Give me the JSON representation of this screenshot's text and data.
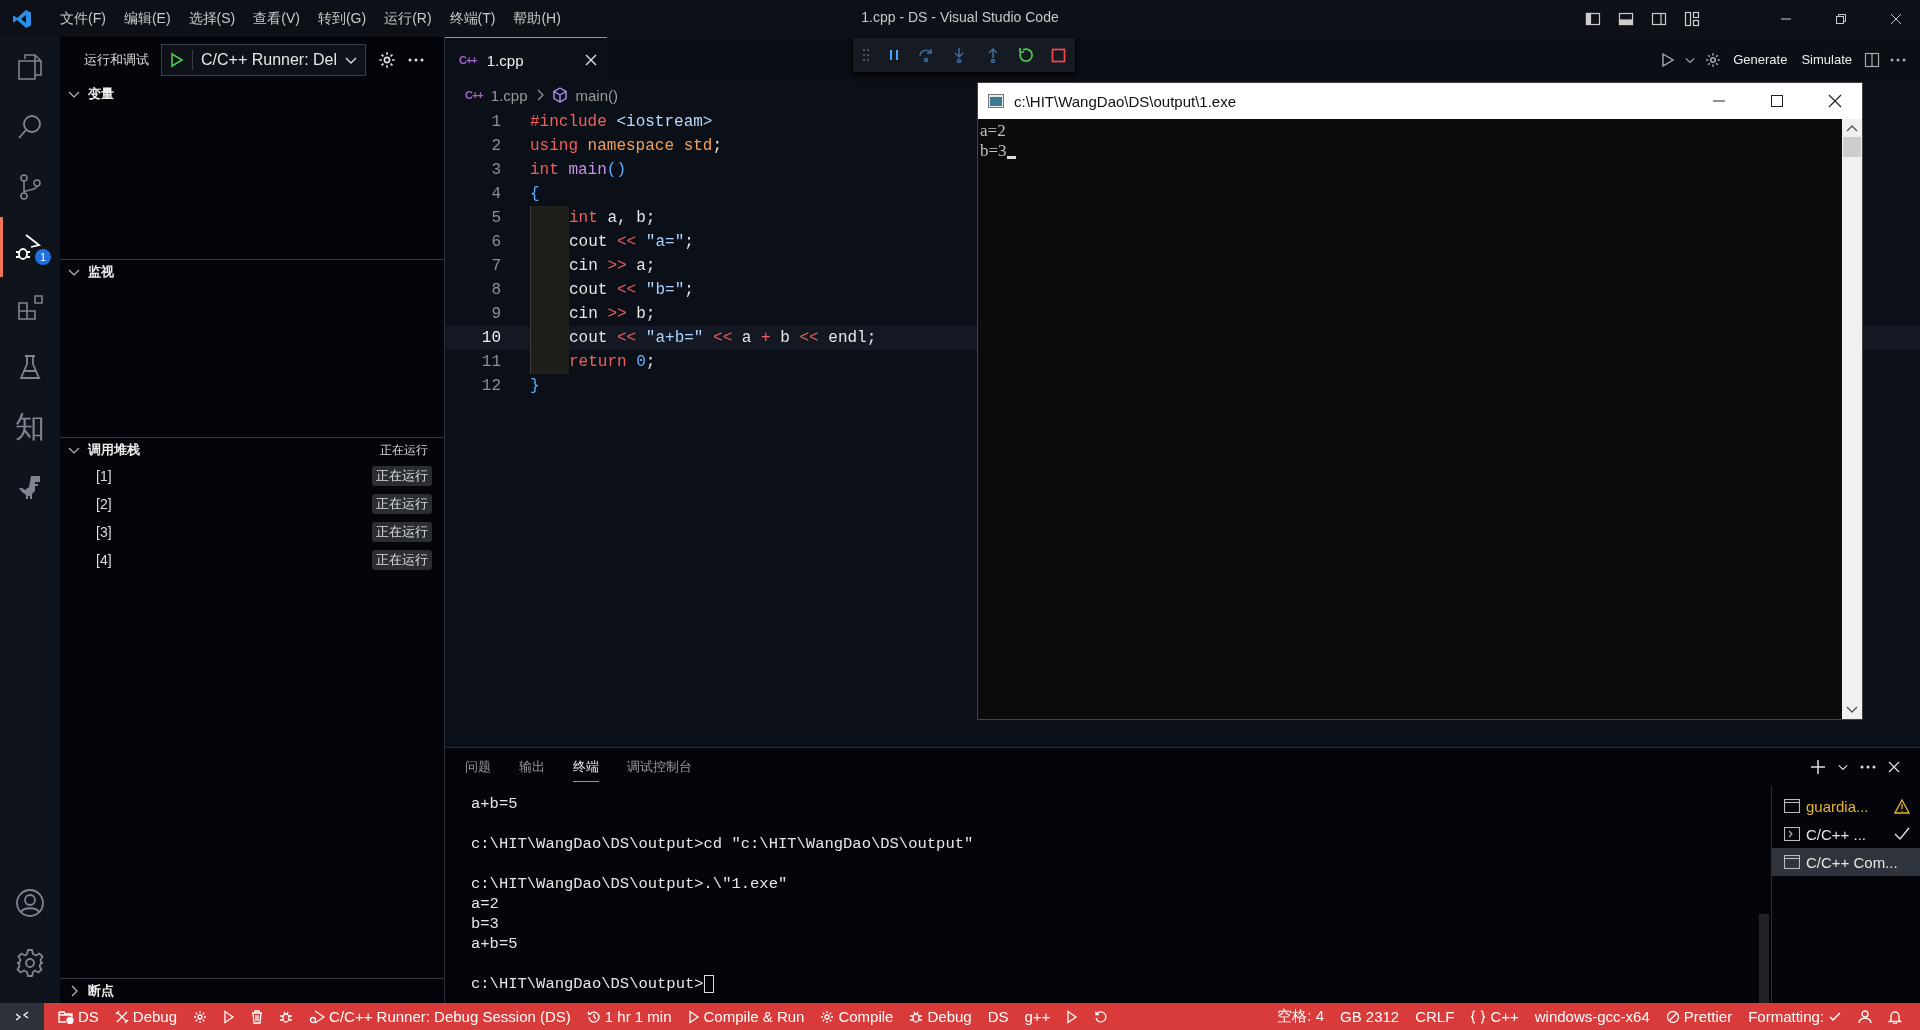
{
  "window": {
    "title": "1.cpp - DS - Visual Studio Code"
  },
  "menu": [
    "文件(F)",
    "编辑(E)",
    "选择(S)",
    "查看(V)",
    "转到(G)",
    "运行(R)",
    "终端(T)",
    "帮助(H)"
  ],
  "activity_bar": {
    "items": [
      {
        "selected": false
      },
      {
        "selected": false
      },
      {
        "selected": false
      },
      {
        "selected": true,
        "badge": "1"
      },
      {
        "selected": false
      },
      {
        "selected": false
      },
      {
        "text": "知",
        "selected": false
      },
      {
        "selected": false
      }
    ]
  },
  "sidebar": {
    "title": "运行和调试",
    "config": "C/C++ Runner: Del",
    "sections": [
      {
        "kind": "empty",
        "title": "变量",
        "expanded": true
      },
      {
        "kind": "empty",
        "title": "监视",
        "expanded": true
      },
      {
        "kind": "stack",
        "title": "调用堆栈",
        "expanded": true,
        "status": "正在运行",
        "rows": [
          {
            "label": "[1]",
            "status": "正在运行"
          },
          {
            "label": "[2]",
            "status": "正在运行"
          },
          {
            "label": "[3]",
            "status": "正在运行"
          },
          {
            "label": "[4]",
            "status": "正在运行"
          }
        ]
      },
      {
        "kind": "empty",
        "title": "断点",
        "expanded": false
      }
    ]
  },
  "editor": {
    "tabs": [
      {
        "badge": "C++",
        "label": "1.cpp",
        "selected": true
      }
    ],
    "breadcrumb_badge": "C++",
    "breadcrumb": [
      "1.cpp",
      "main()"
    ],
    "toolbar_buttons": [
      "Generate",
      "Simulate"
    ],
    "lines": [
      {
        "number": "1",
        "current": false,
        "indented": false,
        "tokens": [
          {
            "text": "#include ",
            "kind": "keyword"
          },
          {
            "text": "<iostream>",
            "kind": "header"
          }
        ]
      },
      {
        "number": "2",
        "current": false,
        "indented": false,
        "tokens": [
          {
            "text": "using ",
            "kind": "keyword"
          },
          {
            "text": "namespace std",
            "kind": "namespace"
          },
          {
            "text": ";",
            "kind": "plain"
          }
        ]
      },
      {
        "number": "3",
        "current": false,
        "indented": false,
        "tokens": [
          {
            "text": "int ",
            "kind": "keyword"
          },
          {
            "text": "main",
            "kind": "function"
          },
          {
            "text": "()",
            "kind": "bracket"
          }
        ]
      },
      {
        "number": "4",
        "current": false,
        "indented": false,
        "tokens": [
          {
            "text": "{",
            "kind": "bracket"
          }
        ]
      },
      {
        "number": "5",
        "current": false,
        "indented": true,
        "tokens": [
          {
            "text": "int",
            "kind": "keyword"
          },
          {
            "text": " a, b;",
            "kind": "plain"
          }
        ]
      },
      {
        "number": "6",
        "current": false,
        "indented": true,
        "tokens": [
          {
            "text": "cout ",
            "kind": "plain"
          },
          {
            "text": "<< ",
            "kind": "operator"
          },
          {
            "text": "\"a=\"",
            "kind": "string"
          },
          {
            "text": ";",
            "kind": "plain"
          }
        ]
      },
      {
        "number": "7",
        "current": false,
        "indented": true,
        "tokens": [
          {
            "text": "cin ",
            "kind": "plain"
          },
          {
            "text": ">>",
            "kind": "operator"
          },
          {
            "text": " a;",
            "kind": "plain"
          }
        ]
      },
      {
        "number": "8",
        "current": false,
        "indented": true,
        "tokens": [
          {
            "text": "cout ",
            "kind": "plain"
          },
          {
            "text": "<< ",
            "kind": "operator"
          },
          {
            "text": "\"b=\"",
            "kind": "string"
          },
          {
            "text": ";",
            "kind": "plain"
          }
        ]
      },
      {
        "number": "9",
        "current": false,
        "indented": true,
        "tokens": [
          {
            "text": "cin ",
            "kind": "plain"
          },
          {
            "text": ">>",
            "kind": "operator"
          },
          {
            "text": " b;",
            "kind": "plain"
          }
        ]
      },
      {
        "number": "10",
        "current": true,
        "indented": true,
        "tokens": [
          {
            "text": "cout ",
            "kind": "plain"
          },
          {
            "text": "<< ",
            "kind": "operator"
          },
          {
            "text": "\"a+b=\" ",
            "kind": "string"
          },
          {
            "text": "<< ",
            "kind": "operator"
          },
          {
            "text": "a ",
            "kind": "plain"
          },
          {
            "text": "+ ",
            "kind": "operator"
          },
          {
            "text": "b ",
            "kind": "plain"
          },
          {
            "text": "<< ",
            "kind": "operator"
          },
          {
            "text": "endl;",
            "kind": "plain"
          }
        ]
      },
      {
        "number": "11",
        "current": false,
        "indented": true,
        "tokens": [
          {
            "text": "return ",
            "kind": "keyword"
          },
          {
            "text": "0",
            "kind": "number"
          },
          {
            "text": ";",
            "kind": "plain"
          }
        ]
      },
      {
        "number": "12",
        "current": false,
        "indented": false,
        "tokens": [
          {
            "text": "}",
            "kind": "bracket"
          }
        ]
      }
    ]
  },
  "console_window": {
    "title": "c:\\HIT\\WangDao\\DS\\output\\1.exe",
    "lines": [
      "a=2",
      "b=3"
    ]
  },
  "panel": {
    "tabs": [
      {
        "label": "问题",
        "selected": false
      },
      {
        "label": "输出",
        "selected": false
      },
      {
        "label": "终端",
        "selected": true
      },
      {
        "label": "调试控制台",
        "selected": false
      }
    ],
    "terminal_blocks": [
      [
        "a+b=5"
      ],
      [
        "c:\\HIT\\WangDao\\DS\\output>cd \"c:\\HIT\\WangDao\\DS\\output\""
      ],
      [
        "c:\\HIT\\WangDao\\DS\\output>.\\\"1.exe\"",
        "a=2",
        "b=3",
        "a+b=5"
      ],
      [
        "c:\\HIT\\WangDao\\DS\\output>"
      ]
    ],
    "terminals": [
      {
        "label": "guardia...",
        "kind": "warning",
        "selected": false
      },
      {
        "label": "C/C++ ...",
        "kind": "done",
        "selected": false
      },
      {
        "label": "C/C++ Com...",
        "kind": "plain",
        "selected": true
      }
    ]
  },
  "status_bar": {
    "left": [
      {
        "kind": "remote"
      },
      {
        "kind": "folder",
        "text": "DS"
      },
      {
        "kind": "tools",
        "text": "Debug"
      },
      {
        "kind": "gear"
      },
      {
        "kind": "play"
      },
      {
        "kind": "trash"
      },
      {
        "kind": "bug"
      },
      {
        "kind": "debug-run",
        "text": "C/C++ Runner: Debug Session (DS)"
      },
      {
        "kind": "history",
        "text": "1 hr 1 min"
      },
      {
        "kind": "play",
        "text": "Compile & Run"
      },
      {
        "kind": "gear",
        "text": "Compile"
      },
      {
        "kind": "bug",
        "text": "Debug"
      },
      {
        "kind": "plain",
        "text": "DS"
      },
      {
        "kind": "plain",
        "text": "g++"
      },
      {
        "kind": "play"
      },
      {
        "kind": "refresh"
      }
    ],
    "right": [
      {
        "kind": "plain",
        "text": "空格: 4"
      },
      {
        "kind": "plain",
        "text": "GB 2312"
      },
      {
        "kind": "plain",
        "text": "CRLF"
      },
      {
        "kind": "braces",
        "text": "C++"
      },
      {
        "kind": "plain",
        "text": "windows-gcc-x64"
      },
      {
        "kind": "blocked",
        "text": "Prettier"
      },
      {
        "kind": "check-after",
        "text": "Formatting:"
      },
      {
        "kind": "person"
      },
      {
        "kind": "bell"
      }
    ]
  }
}
